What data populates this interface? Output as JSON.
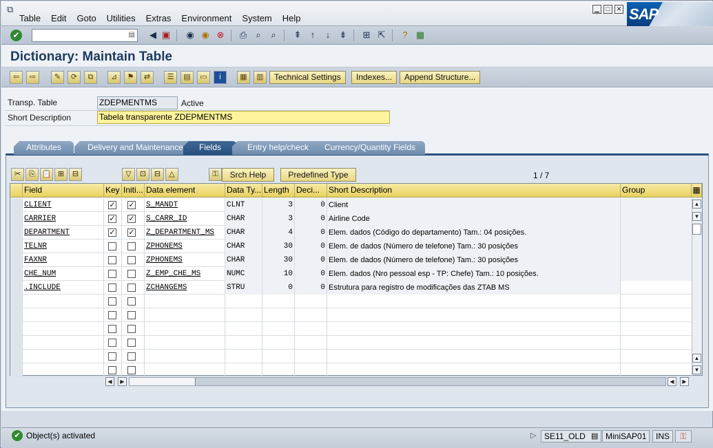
{
  "menu": [
    "Table",
    "Edit",
    "Goto",
    "Utilities",
    "Extras",
    "Environment",
    "System",
    "Help"
  ],
  "brand": "SAP",
  "window_controls": [
    "minimize",
    "maximize",
    "close"
  ],
  "title": "Dictionary: Maintain Table",
  "app_toolbar": {
    "technical_settings": "Technical Settings",
    "indexes": "Indexes...",
    "append_structure": "Append Structure..."
  },
  "header_fields": {
    "transp_table_label": "Transp. Table",
    "transp_table_value": "ZDEPMENTMS",
    "status": "Active",
    "short_desc_label": "Short Description",
    "short_desc_value": "Tabela transparente ZDEPMENTMS"
  },
  "tabs": [
    "Attributes",
    "Delivery and Maintenance",
    "Fields",
    "Entry help/check",
    "Currency/Quantity Fields"
  ],
  "active_tab": "Fields",
  "table_toolbar": {
    "srch_help": "Srch Help",
    "predefined_type": "Predefined Type",
    "page_info": "1 / 7"
  },
  "columns": [
    "Field",
    "Key",
    "Initi...",
    "Data element",
    "Data Ty...",
    "Length",
    "Deci...",
    "Short Description",
    "Group"
  ],
  "rows": [
    {
      "field": "CLIENT",
      "key": true,
      "init": true,
      "element": "S_MANDT",
      "type": "CLNT",
      "length": "3",
      "dec": "0",
      "desc": "Client"
    },
    {
      "field": "CARRIER",
      "key": true,
      "init": true,
      "element": "S_CARR_ID",
      "type": "CHAR",
      "length": "3",
      "dec": "0",
      "desc": "Airline Code"
    },
    {
      "field": "DEPARTMENT",
      "key": true,
      "init": true,
      "element": "Z_DEPARTMENT_MS",
      "type": "CHAR",
      "length": "4",
      "dec": "0",
      "desc": "Elem. dados (Código do departamento) Tam.: 04 posições."
    },
    {
      "field": "TELNR",
      "key": false,
      "init": false,
      "element": "ZPHONEMS",
      "type": "CHAR",
      "length": "30",
      "dec": "0",
      "desc": "Elem. de dados (Número de telefone) Tam.: 30 posições"
    },
    {
      "field": "FAXNR",
      "key": false,
      "init": false,
      "element": "ZPHONEMS",
      "type": "CHAR",
      "length": "30",
      "dec": "0",
      "desc": "Elem. de dados (Número de telefone) Tam.: 30 posições"
    },
    {
      "field": "CHE_NUM",
      "key": false,
      "init": false,
      "element": "Z_EMP_CHE_MS",
      "type": "NUMC",
      "length": "10",
      "dec": "0",
      "desc": "Elem. dados (Nro pessoal esp - TP: Chefe) Tam.: 10 posições."
    },
    {
      "field": ".INCLUDE",
      "key": false,
      "init": false,
      "element": "ZCHANGEMS",
      "type": "STRU",
      "length": "0",
      "dec": "0",
      "desc": "Estrutura para registro de modificações das ZTAB MS"
    }
  ],
  "empty_rows": 6,
  "status_bar": {
    "message": "Object(s) activated",
    "transaction": "SE11_OLD",
    "system": "MiniSAP01",
    "mode": "INS"
  }
}
